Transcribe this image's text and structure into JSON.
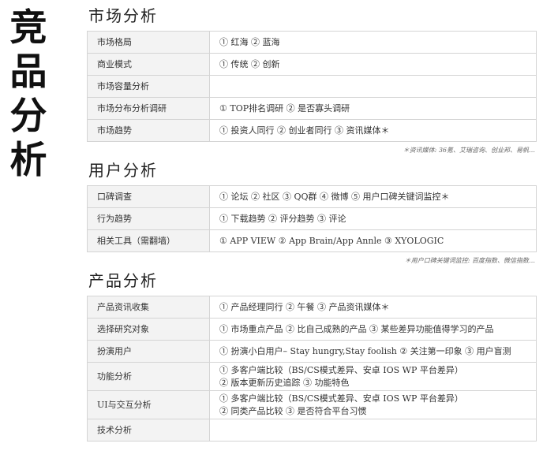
{
  "big_title": [
    "竞",
    "品",
    "分",
    "析"
  ],
  "sections": [
    {
      "title": "市场分析",
      "rows": [
        {
          "label": "市场格局",
          "value": "① 红海 ② 蓝海"
        },
        {
          "label": "商业模式",
          "value": "① 传统 ② 创新"
        },
        {
          "label": "市场容量分析",
          "value": ""
        },
        {
          "label": "市场分布分析调研",
          "value": "① TOP排名调研 ② 是否寡头调研"
        },
        {
          "label": "市场趋势",
          "value": "① 投资人同行 ② 创业者同行 ③ 资讯媒体＊"
        }
      ],
      "note": "＊资讯媒体: 36氪、艾瑞咨询、创业邦、易帆…"
    },
    {
      "title": "用户分析",
      "rows": [
        {
          "label": "口碑调查",
          "value": "① 论坛 ② 社区 ③ QQ群 ④ 微博 ⑤ 用户口碑关键词监控＊"
        },
        {
          "label": "行为趋势",
          "value": "① 下载趋势 ② 评分趋势 ③ 评论"
        },
        {
          "label": "相关工具（需翻墙）",
          "value": "① APP VIEW ② App Brain/App Annle ③ XYOLOGIC"
        }
      ],
      "note": "＊用户口碑关键词监控: 百度指数、微信指数…"
    },
    {
      "title": "产品分析",
      "rows": [
        {
          "label": "产品资讯收集",
          "value": "① 产品经理同行 ② 午餐 ③ 产品资讯媒体＊"
        },
        {
          "label": "选择研究对象",
          "value": "① 市场重点产品 ② 比自己成熟的产品 ③ 某些差异功能值得学习的产品"
        },
        {
          "label": "扮演用户",
          "value": "① 扮演小白用户– Stay hungry,Stay foolish ② 关注第一印象 ③ 用户盲测"
        },
        {
          "label": "功能分析",
          "value_lines": [
            "① 多客户端比较（BS/CS模式差异、安卓 IOS WP 平台差异）",
            "② 版本更新历史追踪 ③ 功能特色"
          ]
        },
        {
          "label": "UI与交互分析",
          "value_lines": [
            "① 多客户端比较（BS/CS模式差异、安卓 IOS WP 平台差异）",
            "② 同类产品比较 ③ 是否符合平台习惯"
          ]
        },
        {
          "label": "技术分析",
          "value": ""
        }
      ]
    }
  ]
}
